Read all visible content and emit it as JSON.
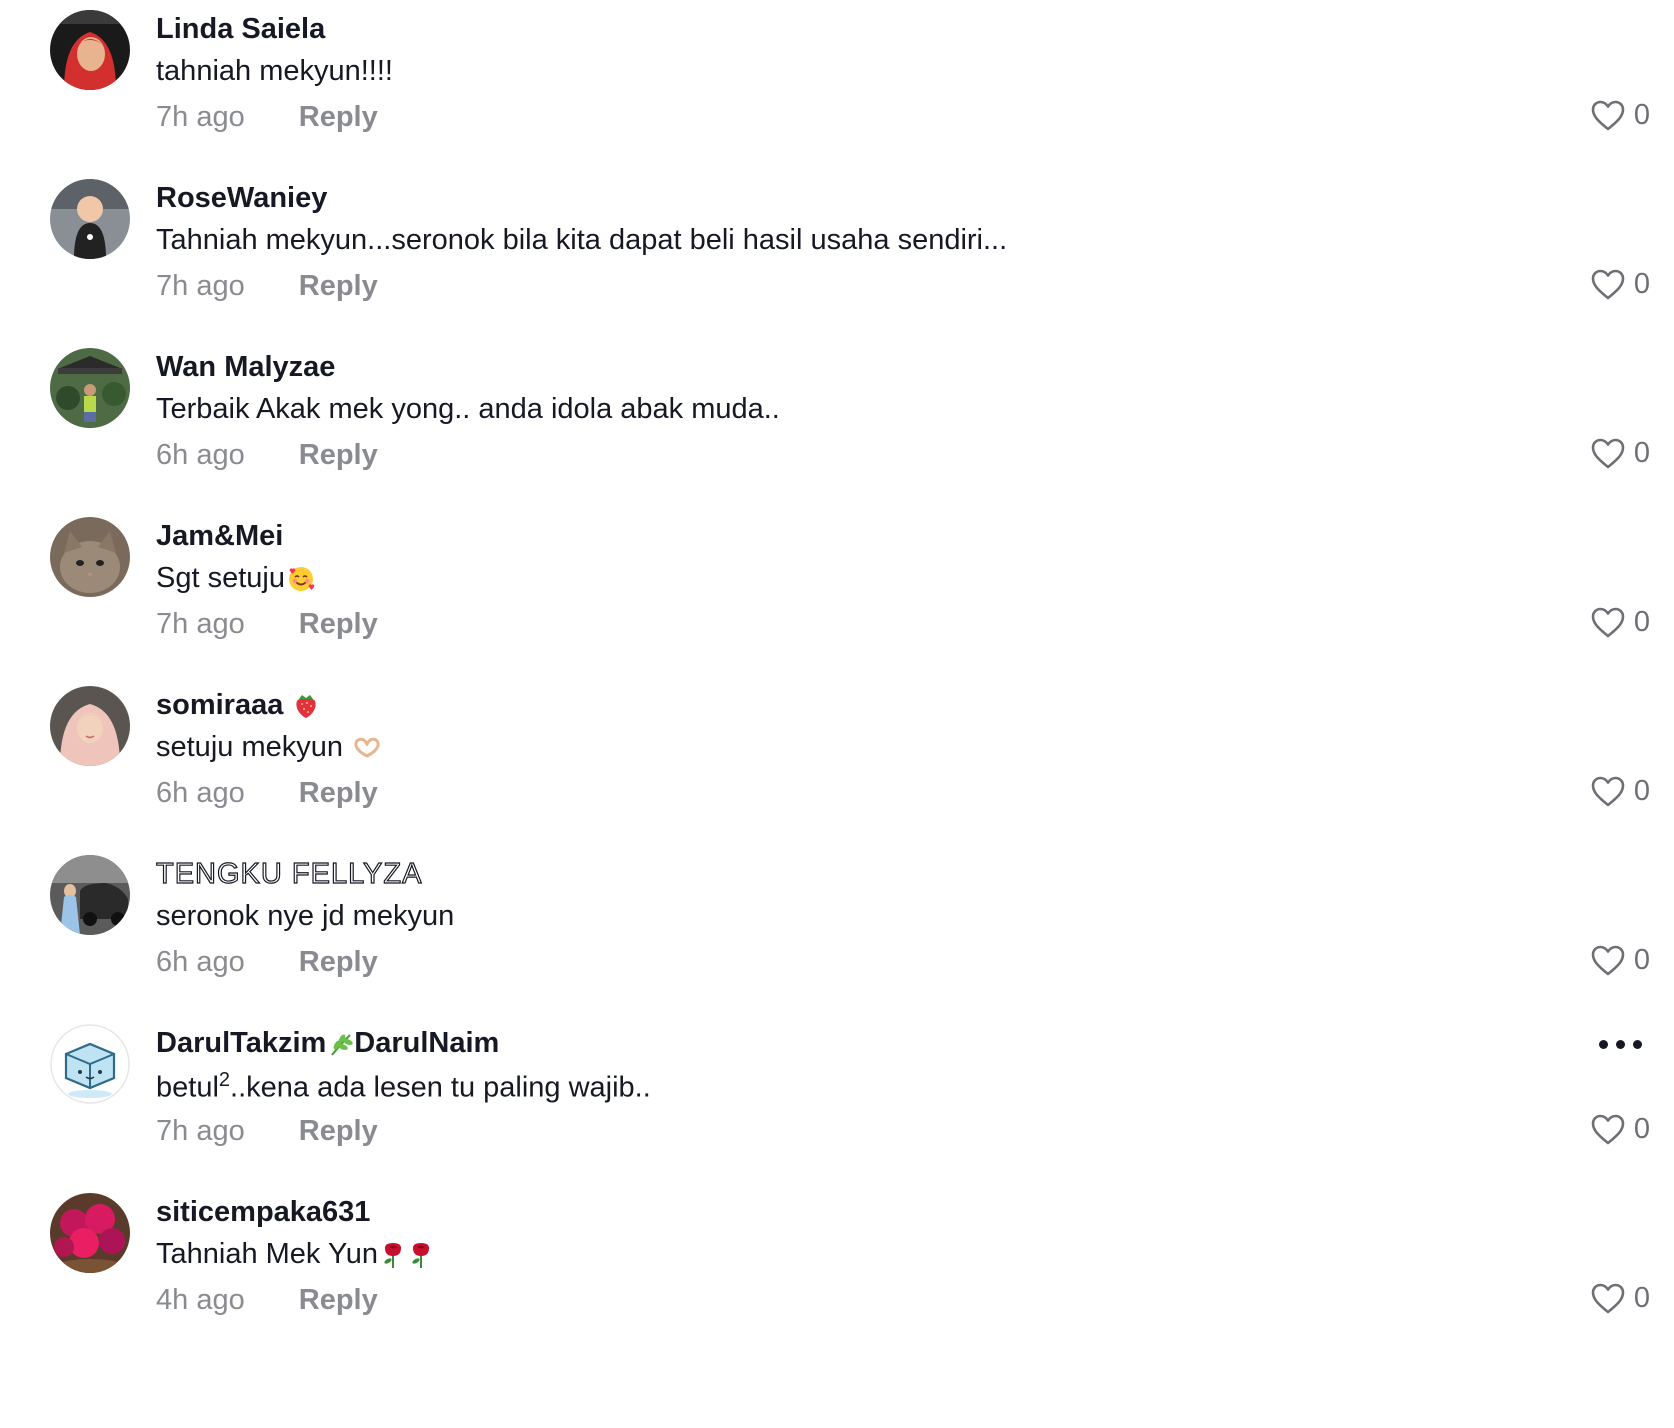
{
  "comments": [
    {
      "username": "Linda Saiela",
      "text": "tahniah mekyun!!!!",
      "time": "7h ago",
      "reply": "Reply",
      "likes": "0",
      "avatar_icon": "avatar-woman-red-hijab",
      "avatar_color": "#c9302c"
    },
    {
      "username": "RoseWaniey",
      "text": "Tahniah mekyun...seronok bila kita dapat beli hasil usaha sendiri...",
      "time": "7h ago",
      "reply": "Reply",
      "likes": "0",
      "avatar_icon": "avatar-baby",
      "avatar_color": "#6b6f78"
    },
    {
      "username": "Wan Malyzae",
      "text": "Terbaik Akak mek yong.. anda idola abak muda..",
      "time": "6h ago",
      "reply": "Reply",
      "likes": "0",
      "avatar_icon": "avatar-garden",
      "avatar_color": "#3f5a3a"
    },
    {
      "username": "Jam&Mei",
      "text": "Sgt setuju",
      "emoji": "smiling-face-with-hearts-emoji",
      "time": "7h ago",
      "reply": "Reply",
      "likes": "0",
      "avatar_icon": "avatar-cat",
      "avatar_color": "#6b5a4a"
    },
    {
      "username": "somiraaa",
      "username_emoji": "strawberry-emoji",
      "text": "setuju mekyun",
      "emoji": "heart-hands-emoji",
      "time": "6h ago",
      "reply": "Reply",
      "likes": "0",
      "avatar_icon": "avatar-woman-pink-hijab",
      "avatar_color": "#e3b7b0"
    },
    {
      "username": "TENGKU FELLYZA",
      "text": "seronok nye jd mekyun",
      "time": "6h ago",
      "reply": "Reply",
      "likes": "0",
      "avatar_icon": "avatar-car",
      "avatar_color": "#4a4a4a"
    },
    {
      "username_part1": "DarulTakzim",
      "username_emoji": "herb-emoji",
      "username_part2": "DarulNaim",
      "text_part1": "betul",
      "text_sup": "2",
      "text_part2": "..kena ada lesen tu paling wajib..",
      "time": "7h ago",
      "reply": "Reply",
      "likes": "0",
      "avatar_icon": "avatar-ice-cube",
      "avatar_color": "#bfe3f2",
      "more_icon": "more-options-icon"
    },
    {
      "username": "siticempaka631",
      "text": "Tahniah Mek Yun",
      "emoji": "rose-emoji",
      "time": "4h ago",
      "reply": "Reply",
      "likes": "0",
      "avatar_icon": "avatar-flowers",
      "avatar_color": "#c2185b"
    }
  ]
}
